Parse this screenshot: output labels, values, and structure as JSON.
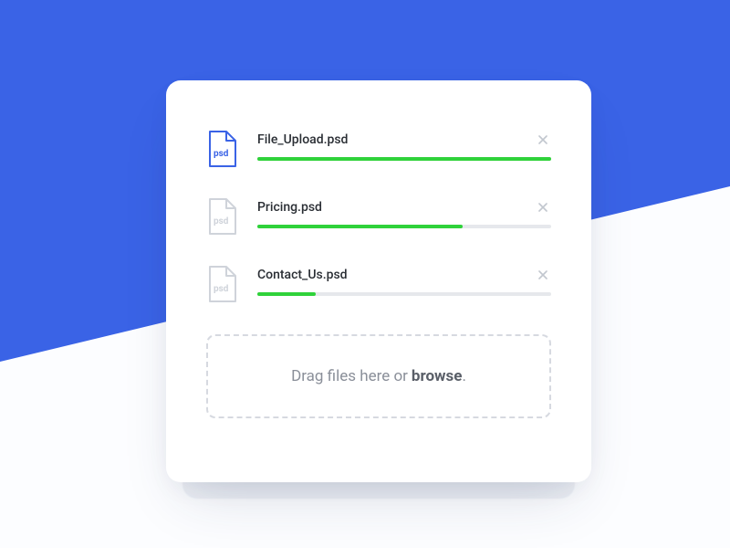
{
  "colors": {
    "accent": "#3a63e6",
    "progress": "#2fd23a",
    "muted_stroke": "#cfd3da"
  },
  "files": [
    {
      "name": "File_Upload.psd",
      "type_label": "psd",
      "progress": 100,
      "state": "active"
    },
    {
      "name": "Pricing.psd",
      "type_label": "psd",
      "progress": 70,
      "state": "inactive"
    },
    {
      "name": "Contact_Us.psd",
      "type_label": "psd",
      "progress": 20,
      "state": "inactive"
    }
  ],
  "dropzone": {
    "prefix": "Drag files here or ",
    "browse": "browse",
    "suffix": "."
  }
}
